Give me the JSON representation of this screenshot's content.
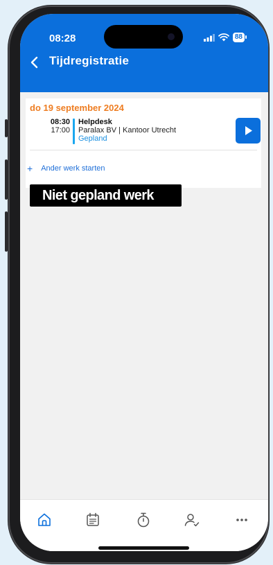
{
  "status_bar": {
    "time": "08:28",
    "battery": "88"
  },
  "header": {
    "title": "Tijdregistratie",
    "back_icon": "chevron-left-icon"
  },
  "card": {
    "date": "do 19 september 2024",
    "entry": {
      "start": "08:30",
      "end": "17:00",
      "task": "Helpdesk",
      "client": "Paralax BV | Kantoor Utrecht",
      "status": "Gepland"
    },
    "add_label": "Ander werk starten",
    "add_icon": "+"
  },
  "caption": "Niet gepland werk",
  "tabbar": {
    "items": [
      {
        "icon": "home-icon",
        "active": true
      },
      {
        "icon": "calendar-list-icon",
        "active": false
      },
      {
        "icon": "stopwatch-icon",
        "active": false
      },
      {
        "icon": "user-check-icon",
        "active": false
      },
      {
        "icon": "more-icon",
        "active": false
      }
    ]
  },
  "colors": {
    "primary": "#0b6fdc",
    "date": "#ee7d22",
    "status": "#1a8fe0",
    "accent_bar": "#1aa7ef"
  }
}
